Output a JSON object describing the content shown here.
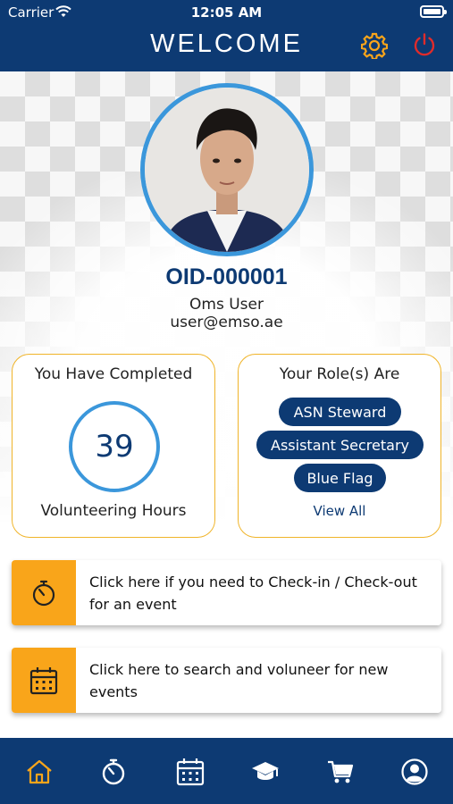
{
  "status_bar": {
    "carrier": "Carrier",
    "time": "12:05 AM"
  },
  "header": {
    "title": "WELCOME"
  },
  "profile": {
    "oid": "OID-000001",
    "name": "Oms User",
    "email": "user@emso.ae"
  },
  "hours_card": {
    "heading": "You Have Completed",
    "value": "39",
    "footer": "Volunteering Hours"
  },
  "roles_card": {
    "heading": "Your Role(s) Are",
    "roles": [
      "ASN Steward",
      "Assistant Secretary",
      "Blue Flag"
    ],
    "view_all": "View All"
  },
  "actions": [
    {
      "label": "Click here if you need to Check-in / Check-out for an event",
      "icon": "stopwatch-icon"
    },
    {
      "label": "Click here to search and voluneer for new events",
      "icon": "calendar-icon"
    }
  ],
  "colors": {
    "navy": "#0d3a73",
    "accent": "#f9a51a",
    "ring": "#3b97db",
    "power": "#e02b2b"
  },
  "nav": [
    "home-icon",
    "stopwatch-icon",
    "calendar-icon",
    "graduation-cap-icon",
    "cart-icon",
    "user-icon"
  ]
}
